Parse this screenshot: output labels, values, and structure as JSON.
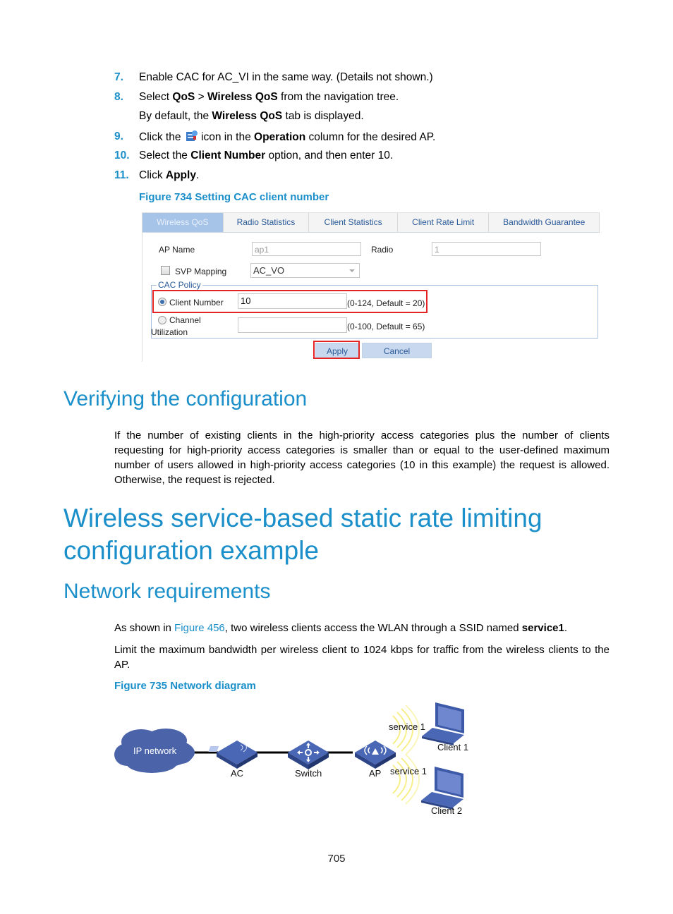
{
  "steps": [
    {
      "num": "7.",
      "parts": [
        {
          "t": "Enable CAC for AC_VI in the same way. (Details not shown.)"
        }
      ]
    },
    {
      "num": "8.",
      "parts": [
        {
          "t": "Select "
        },
        {
          "t": "QoS",
          "b": true
        },
        {
          "t": " > "
        },
        {
          "t": "Wireless QoS",
          "b": true
        },
        {
          "t": " from the navigation tree."
        }
      ]
    },
    {
      "num": "",
      "parts": [
        {
          "t": "By default, the "
        },
        {
          "t": "Wireless QoS",
          "b": true
        },
        {
          "t": " tab is displayed."
        }
      ]
    },
    {
      "num": "9.",
      "parts": [
        {
          "t": "Click the "
        },
        {
          "icon": "operation-icon"
        },
        {
          "t": " icon in the "
        },
        {
          "t": "Operation",
          "b": true
        },
        {
          "t": " column for the desired AP."
        }
      ]
    },
    {
      "num": "10.",
      "parts": [
        {
          "t": "Select the "
        },
        {
          "t": "Client Number",
          "b": true
        },
        {
          "t": " option, and then enter 10."
        }
      ]
    },
    {
      "num": "11.",
      "parts": [
        {
          "t": "Click "
        },
        {
          "t": "Apply",
          "b": true
        },
        {
          "t": "."
        }
      ]
    }
  ],
  "figure734": {
    "caption": "Figure 734 Setting CAC client number",
    "tabs": [
      {
        "label": "Wireless QoS",
        "active": true
      },
      {
        "label": "Radio Statistics",
        "active": false
      },
      {
        "label": "Client Statistics",
        "active": false
      },
      {
        "label": "Client Rate Limit",
        "active": false
      },
      {
        "label": "Bandwidth Guarantee",
        "active": false
      }
    ],
    "ap_name_label": "AP Name",
    "ap_name_value": "ap1",
    "radio_label": "Radio",
    "radio_value": "1",
    "svp_mapping_label": "SVP Mapping",
    "svp_mapping_checked": false,
    "svp_mapping_value": "AC_VO",
    "cac_policy_legend": "CAC Policy",
    "client_number_label": "Client Number",
    "client_number_selected": true,
    "client_number_value": "10",
    "client_number_hint": "(0-124, Default = 20)",
    "channel_label_line1": "Channel",
    "channel_label_line2": "Utilization",
    "channel_selected": false,
    "channel_value": "",
    "channel_hint": "(0-100, Default = 65)",
    "apply_label": "Apply",
    "cancel_label": "Cancel",
    "highlight_color": "#e32424"
  },
  "verifying": {
    "heading": "Verifying the configuration",
    "paragraph": "If the number of existing clients in the high-priority access categories plus the number of clients requesting for high-priority access categories is smaller than or equal to the user-defined maximum number of users allowed in high-priority access categories (10 in this example) the request is allowed. Otherwise, the request is rejected."
  },
  "chapter": {
    "heading_line1": "Wireless service-based static rate limiting",
    "heading_line2": "configuration example"
  },
  "network_requirements": {
    "heading": "Network requirements",
    "p1_before": "As shown in ",
    "p1_link": "Figure 456",
    "p1_middle": ", two wireless clients access the WLAN through a SSID named ",
    "p1_bold": "service1",
    "p1_after": ".",
    "p2": "Limit the maximum bandwidth per wireless client to 1024 kbps for traffic from the wireless clients to the AP."
  },
  "figure735": {
    "caption": "Figure 735 Network diagram",
    "cloud_label": "IP network",
    "ac_label": "AC",
    "switch_label": "Switch",
    "ap_label": "AP",
    "ssid1_label": "service 1",
    "ssid2_label": "service 1",
    "client1_label": "Client 1",
    "client2_label": "Client 2"
  },
  "accent_color": "#1a8fc9",
  "page_number": "705"
}
